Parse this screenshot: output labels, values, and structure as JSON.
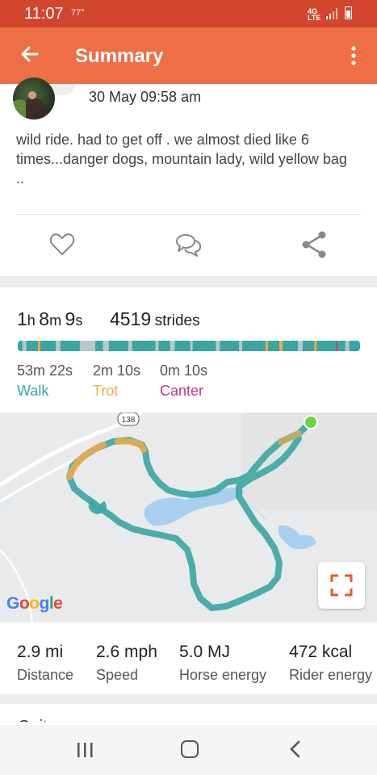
{
  "status_bar": {
    "time": "11:07",
    "temperature": "77°",
    "network": "4G LTE"
  },
  "app_bar": {
    "title": "Summary",
    "back_icon": "arrow-left-icon",
    "menu_icon": "more-vertical-icon",
    "color": "#ee6e45"
  },
  "post": {
    "date": "30 May 09:58 am",
    "text": "wild ride. had to get off . we almost died like 6 times...danger dogs, mountain lady, wild yellow bag ..",
    "actions": [
      "heart-icon",
      "comment-icon",
      "share-icon"
    ]
  },
  "summary": {
    "duration_h": "1",
    "unit_h": "h",
    "duration_m": "8",
    "unit_m": "m",
    "duration_s": "9",
    "unit_s": "s",
    "strides_count": "4519",
    "strides_label": "strides"
  },
  "gaits": [
    {
      "time": "53m 22s",
      "label": "Walk",
      "color": "#3aa6a0"
    },
    {
      "time": "2m 10s",
      "label": "Trot",
      "color": "#f2aa46"
    },
    {
      "time": "0m 10s",
      "label": "Canter",
      "color": "#c8357a"
    }
  ],
  "gait_bar": {
    "segments": [
      {
        "gait": "walk",
        "share": 0.012
      },
      {
        "gait": "other",
        "share": 0.01
      },
      {
        "gait": "walk",
        "share": 0.03
      },
      {
        "gait": "trot",
        "share": 0.006
      },
      {
        "gait": "walk",
        "share": 0.04
      },
      {
        "gait": "other",
        "share": 0.012
      },
      {
        "gait": "walk",
        "share": 0.05
      },
      {
        "gait": "other",
        "share": 0.04
      },
      {
        "gait": "walk",
        "share": 0.02
      },
      {
        "gait": "other",
        "share": 0.015
      },
      {
        "gait": "walk",
        "share": 0.05
      },
      {
        "gait": "other",
        "share": 0.01
      },
      {
        "gait": "walk",
        "share": 0.06
      },
      {
        "gait": "other",
        "share": 0.008
      },
      {
        "gait": "walk",
        "share": 0.03
      },
      {
        "gait": "other",
        "share": 0.012
      },
      {
        "gait": "walk",
        "share": 0.04
      },
      {
        "gait": "other",
        "share": 0.006
      },
      {
        "gait": "walk",
        "share": 0.06
      },
      {
        "gait": "other",
        "share": 0.01
      },
      {
        "gait": "walk",
        "share": 0.05
      },
      {
        "gait": "other",
        "share": 0.008
      },
      {
        "gait": "walk",
        "share": 0.06
      },
      {
        "gait": "trot",
        "share": 0.006
      },
      {
        "gait": "walk",
        "share": 0.03
      },
      {
        "gait": "trot",
        "share": 0.008
      },
      {
        "gait": "walk",
        "share": 0.04
      },
      {
        "gait": "other",
        "share": 0.012
      },
      {
        "gait": "walk",
        "share": 0.03
      },
      {
        "gait": "trot",
        "share": 0.006
      },
      {
        "gait": "walk",
        "share": 0.05
      },
      {
        "gait": "canter",
        "share": 0.004
      },
      {
        "gait": "walk",
        "share": 0.02
      },
      {
        "gait": "other",
        "share": 0.01
      },
      {
        "gait": "walk",
        "share": 0.028
      }
    ],
    "colors": {
      "walk": "#3aa6a0",
      "trot": "#f2aa46",
      "canter": "#c8357a",
      "other": "#b8c8c8"
    }
  },
  "map": {
    "road_shield": "138",
    "attribution": "Google",
    "expand_icon": "fullscreen-icon",
    "track_color": "#3aa6a0",
    "start_marker_color": "#6ad44a"
  },
  "stats": [
    {
      "value": "2.9 mi",
      "label": "Distance"
    },
    {
      "value": "2.6 mph",
      "label": "Speed"
    },
    {
      "value": "5.0 MJ",
      "label": "Horse energy"
    },
    {
      "value": "472 kcal",
      "label": "Rider energy"
    }
  ],
  "next_section_partial": "Gaits",
  "nav_bar": [
    "recent-apps-icon",
    "home-icon",
    "back-icon"
  ]
}
